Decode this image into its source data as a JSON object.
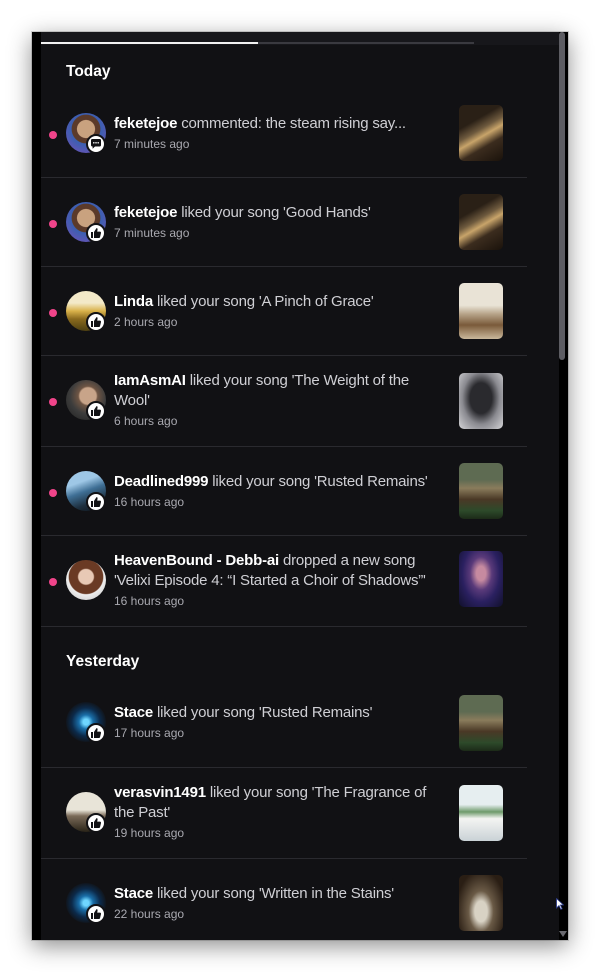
{
  "sections": {
    "today": "Today",
    "yesterday": "Yesterday"
  },
  "notifications": [
    {
      "user": "feketejoe",
      "text": "commented: the steam rising say...",
      "time": "7 minutes ago",
      "badge": "comment-icon",
      "unread": true
    },
    {
      "user": "feketejoe",
      "text": "liked your song 'Good Hands'",
      "time": "7 minutes ago",
      "badge": "thumbs-up-icon",
      "unread": true
    },
    {
      "user": "Linda",
      "text": "liked your song 'A Pinch of Grace'",
      "time": "2 hours ago",
      "badge": "thumbs-up-icon",
      "unread": true
    },
    {
      "user": "IamAsmAI",
      "text": "liked your song 'The Weight of the Wool'",
      "time": "6 hours ago",
      "badge": "thumbs-up-icon",
      "unread": true
    },
    {
      "user": "Deadlined999",
      "text": "liked your song 'Rusted Remains'",
      "time": "16 hours ago",
      "badge": "thumbs-up-icon",
      "unread": true
    },
    {
      "user": "HeavenBound - Debb-ai",
      "text": "dropped a new song 'Velixi Episode 4: “I Started a Choir of Shadows”'",
      "time": "16 hours ago",
      "badge": "none",
      "unread": true
    },
    {
      "user": "Stace",
      "text": "liked your song 'Rusted Remains'",
      "time": "17 hours ago",
      "badge": "thumbs-up-icon",
      "unread": false
    },
    {
      "user": "verasvin1491",
      "text": "liked your song 'The Fragrance of the Past'",
      "time": "19 hours ago",
      "badge": "thumbs-up-icon",
      "unread": false
    },
    {
      "user": "Stace",
      "text": "liked your song 'Written in the Stains'",
      "time": "22 hours ago",
      "badge": "thumbs-up-icon",
      "unread": false
    }
  ],
  "colors": {
    "panel": "#111114",
    "unread_dot": "#f0448a",
    "name": "#ffffff",
    "text": "#cfcfd4",
    "time": "#a9a9b0"
  }
}
